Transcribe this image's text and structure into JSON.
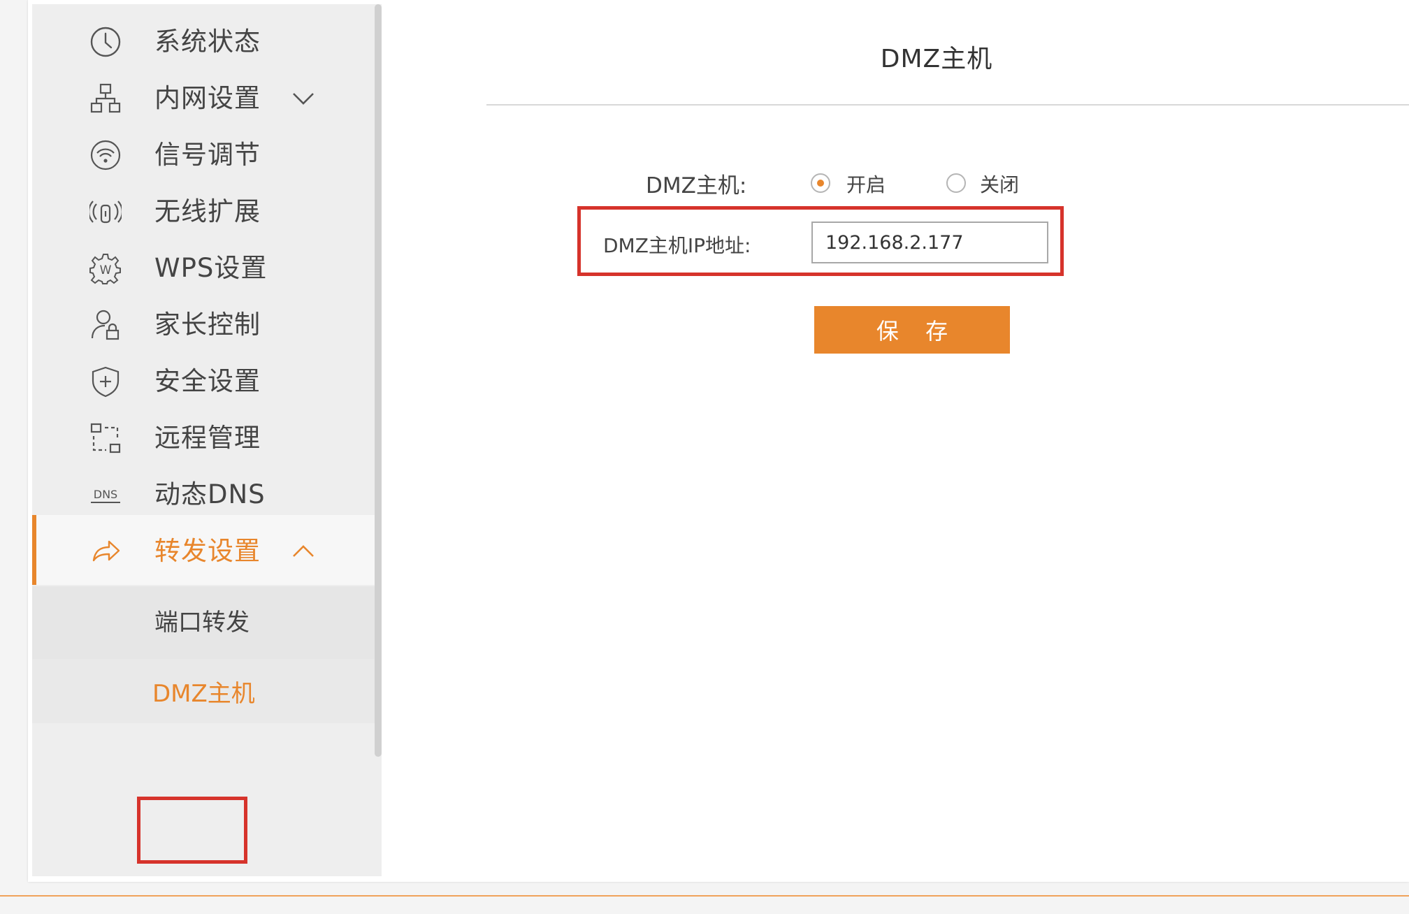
{
  "colors": {
    "accent": "#e8862c",
    "highlight_box": "#d6332b"
  },
  "sidebar": {
    "items": [
      {
        "label": "系统状态",
        "icon": "clock-icon"
      },
      {
        "label": "内网设置",
        "icon": "network-icon",
        "chevron": "down"
      },
      {
        "label": "信号调节",
        "icon": "signal-icon"
      },
      {
        "label": "无线扩展",
        "icon": "extender-icon"
      },
      {
        "label": "WPS设置",
        "icon": "wps-gear-icon"
      },
      {
        "label": "家长控制",
        "icon": "parental-icon"
      },
      {
        "label": "安全设置",
        "icon": "shield-icon"
      },
      {
        "label": "远程管理",
        "icon": "remote-icon"
      },
      {
        "label": "动态DNS",
        "icon": "dns-icon"
      },
      {
        "label": "转发设置",
        "icon": "forward-icon",
        "chevron": "up",
        "active": true
      }
    ],
    "dns_icon_text": "DNS",
    "wps_icon_text": "W",
    "subitems": [
      {
        "label": "端口转发"
      },
      {
        "label": "DMZ主机",
        "active": true
      }
    ]
  },
  "main": {
    "title": "DMZ主机",
    "dmz_label": "DMZ主机:",
    "radio_on_label": "开启",
    "radio_off_label": "关闭",
    "radio_selected": "开启",
    "ip_label": "DMZ主机IP地址:",
    "ip_value": "192.168.2.177",
    "save_label": "保 存"
  }
}
